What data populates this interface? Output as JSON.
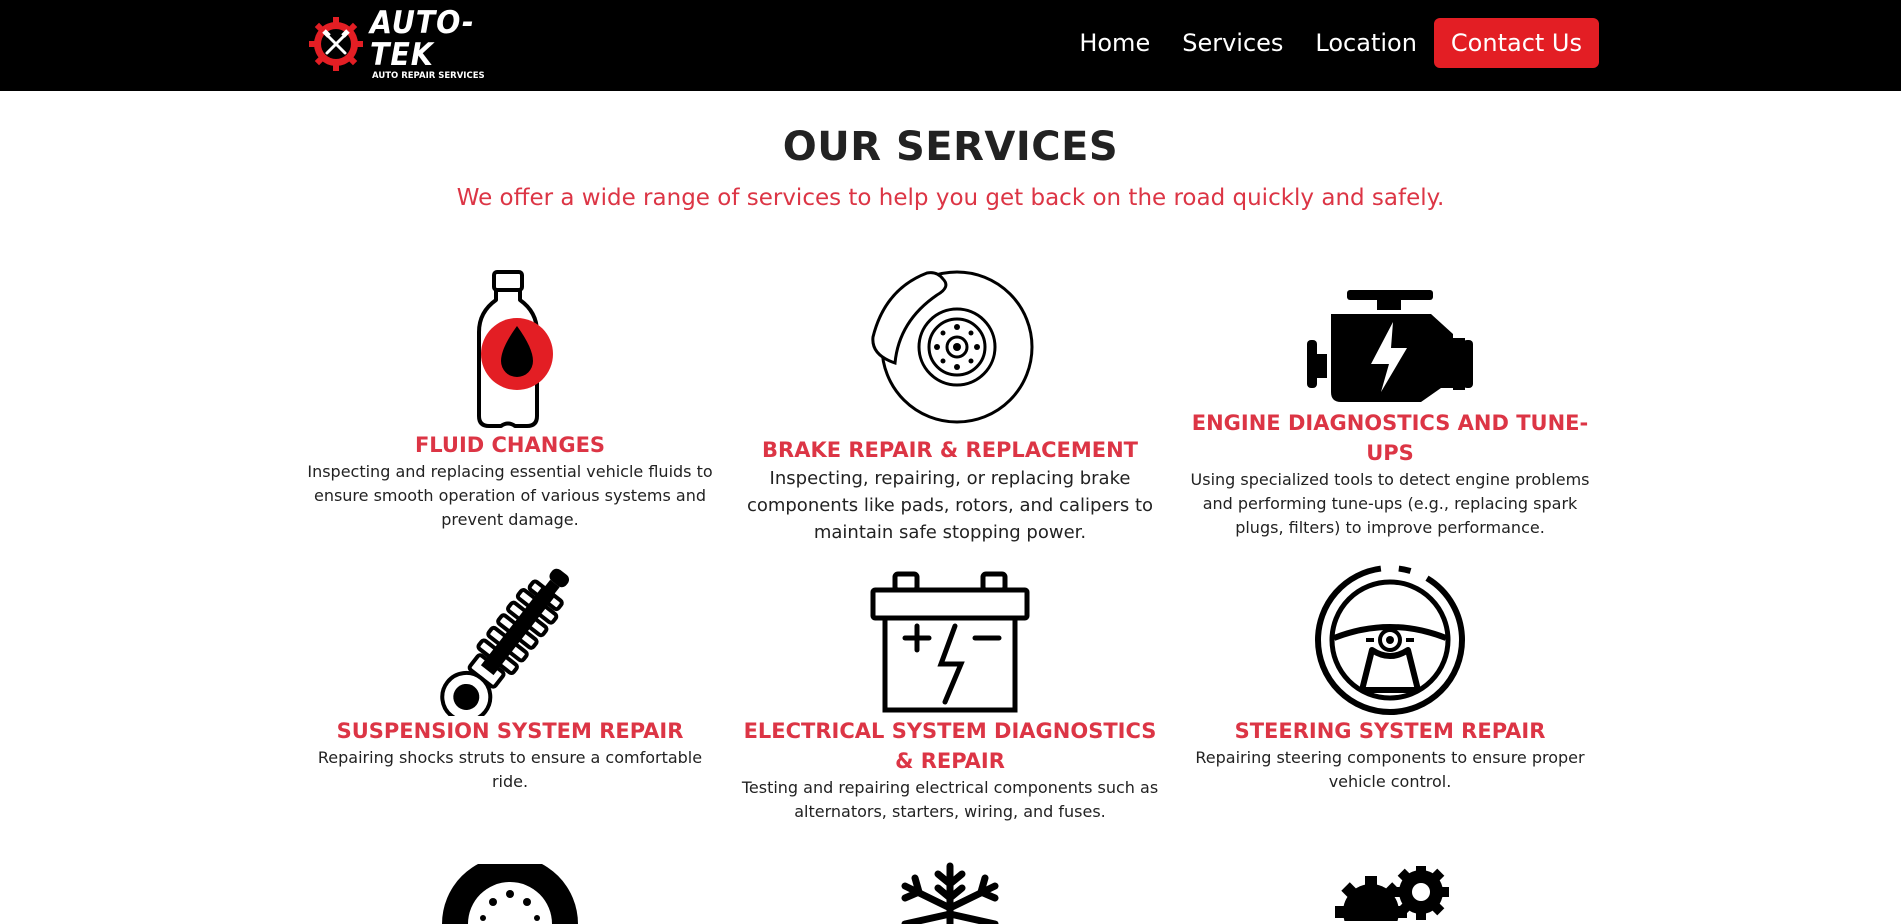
{
  "brand": {
    "name": "AUTO-TEK",
    "tagline": "AUTO REPAIR SERVICES",
    "accent_color": "#e31e24",
    "icon": "crossed-pistons-gear-icon"
  },
  "nav": {
    "items": [
      {
        "label": "Home"
      },
      {
        "label": "Services"
      },
      {
        "label": "Location"
      }
    ],
    "cta_label": "Contact Us"
  },
  "services_section": {
    "title": "OUR SERVICES",
    "subtitle": "We offer a wide range of services to help you get back on the road quickly and safely.",
    "items": [
      {
        "title": "FLUID CHANGES",
        "description": "Inspecting and replacing essential vehicle fluids to ensure smooth operation of various systems and prevent damage.",
        "icon": "fluid-bottle-icon"
      },
      {
        "title": "BRAKE REPAIR & REPLACEMENT",
        "description": "Inspecting, repairing, or replacing brake components like pads, rotors, and calipers to maintain safe stopping power.",
        "icon": "brake-disc-icon"
      },
      {
        "title": "ENGINE DIAGNOSTICS AND TUNE-UPS",
        "description": "Using specialized tools to detect engine problems and performing tune-ups (e.g., replacing spark plugs, filters) to improve performance.",
        "icon": "engine-icon"
      },
      {
        "title": "SUSPENSION SYSTEM REPAIR",
        "description": "Repairing shocks struts to ensure a comfortable ride.",
        "icon": "shock-absorber-icon"
      },
      {
        "title": "ELECTRICAL SYSTEM DIAGNOSTICS & REPAIR",
        "description": "Testing and repairing electrical components such as alternators, starters, wiring, and fuses.",
        "icon": "car-battery-icon"
      },
      {
        "title": "STEERING SYSTEM REPAIR",
        "description": "Repairing steering components to ensure proper vehicle control.",
        "icon": "steering-wheel-icon"
      },
      {
        "title": "",
        "description": "",
        "icon": "tire-icon"
      },
      {
        "title": "",
        "description": "",
        "icon": "snowflake-icon"
      },
      {
        "title": "",
        "description": "",
        "icon": "gears-icon"
      }
    ]
  }
}
